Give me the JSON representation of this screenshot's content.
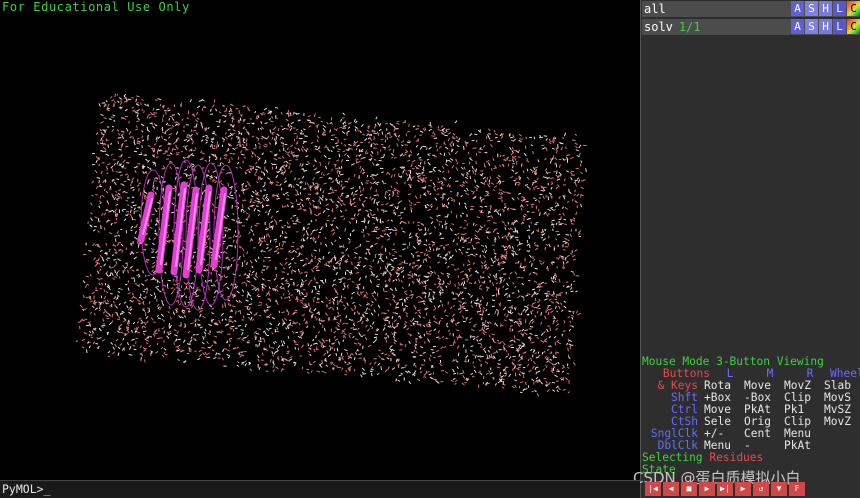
{
  "viewer": {
    "notice": "For Educational Use Only"
  },
  "objects": [
    {
      "name": "all",
      "state": "",
      "buttons": [
        "A",
        "S",
        "H",
        "L",
        "C"
      ]
    },
    {
      "name": "solv",
      "state": "1/1",
      "buttons": [
        "A",
        "S",
        "H",
        "L",
        "C"
      ]
    }
  ],
  "mouse_panel": {
    "title": "Mouse Mode 3-Button Viewing",
    "header": {
      "label": "Buttons",
      "cols": [
        "L",
        "M",
        "R",
        "Wheel"
      ]
    },
    "rows": [
      {
        "label": "& Keys",
        "cols": [
          "Rota",
          "Move",
          "MovZ",
          "Slab"
        ]
      },
      {
        "label": "Shft",
        "cols": [
          "+Box",
          "-Box",
          "Clip",
          "MovS"
        ]
      },
      {
        "label": "Ctrl",
        "cols": [
          "Move",
          "PkAt",
          "Pk1",
          "MvSZ"
        ]
      },
      {
        "label": "CtSh",
        "cols": [
          "Sele",
          "Orig",
          "Clip",
          "MovZ"
        ]
      },
      {
        "label": "SnglClk",
        "cols": [
          "+/-",
          "Cent",
          "Menu",
          ""
        ]
      },
      {
        "label": "DblClk",
        "cols": [
          "Menu",
          "-",
          "PkAt",
          ""
        ]
      }
    ],
    "selecting_label": "Selecting",
    "selecting_value": "Residues",
    "state_label": "State"
  },
  "command": {
    "prompt": "PyMOL>_"
  },
  "transport": [
    "|◀",
    "◀",
    "■",
    "▶",
    "▶|",
    "▶",
    "↺",
    "▼",
    "F"
  ],
  "watermark": "CSDN @蛋白质模拟小白",
  "colors": {
    "green": "#3fd23f",
    "red": "#e84a4a",
    "blue": "#6a6aff",
    "water": "#d89a9a",
    "helix": "#e040d0"
  }
}
